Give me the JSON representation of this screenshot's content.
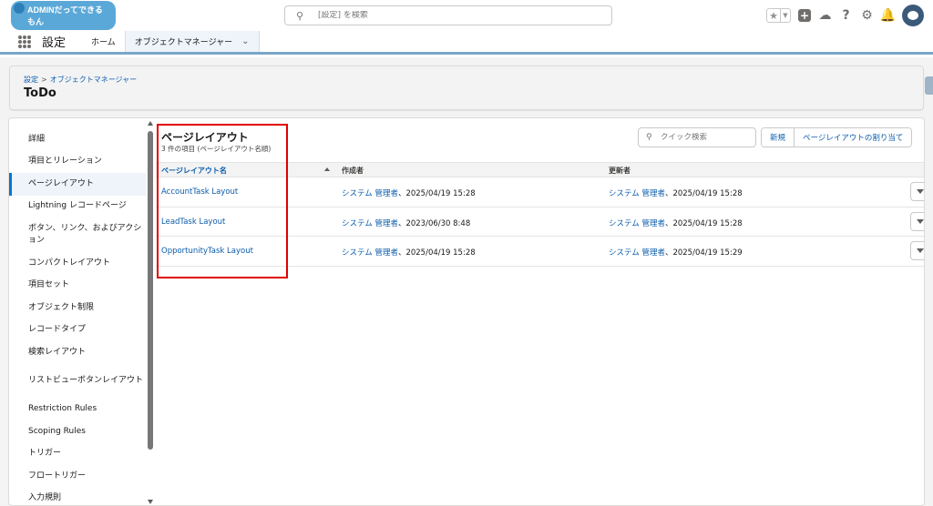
{
  "header": {
    "logo_text": "ADMINだってできるもん",
    "search_placeholder": "[設定] を検索",
    "icons": [
      "star-icon",
      "chevron-down-icon",
      "plus-icon",
      "cloud-icon",
      "help-icon",
      "gear-icon",
      "bell-icon",
      "avatar"
    ]
  },
  "nav": {
    "app_name": "設定",
    "tabs": [
      {
        "label": "ホーム",
        "active": false
      },
      {
        "label": "オブジェクトマネージャー",
        "active": true
      }
    ]
  },
  "object_header": {
    "breadcrumb": [
      "設定",
      "オブジェクトマネージャー"
    ],
    "breadcrumb_sep": ">",
    "title": "ToDo"
  },
  "sidebar": {
    "items": [
      {
        "label": "詳細",
        "active": false
      },
      {
        "label": "項目とリレーション",
        "active": false
      },
      {
        "label": "ページレイアウト",
        "active": true
      },
      {
        "label": "Lightning レコードページ",
        "active": false
      },
      {
        "label": "ボタン、リンク、およびアクション",
        "active": false
      },
      {
        "label": "コンパクトレイアウト",
        "active": false
      },
      {
        "label": "項目セット",
        "active": false
      },
      {
        "label": "オブジェクト制限",
        "active": false
      },
      {
        "label": "レコードタイプ",
        "active": false
      },
      {
        "label": "検索レイアウト",
        "active": false
      },
      {
        "label": "リストビューボタンレイアウト",
        "active": false
      },
      {
        "label": "Restriction Rules",
        "active": false
      },
      {
        "label": "Scoping Rules",
        "active": false
      },
      {
        "label": "トリガー",
        "active": false
      },
      {
        "label": "フロートリガー",
        "active": false
      },
      {
        "label": "入力規則",
        "active": false
      }
    ]
  },
  "main": {
    "title": "ページレイアウト",
    "subtitle": "3 件の項目 (ページレイアウト名順)",
    "quick_search_placeholder": "クイック検索",
    "buttons": {
      "new": "新規",
      "assign": "ページレイアウトの割り当て"
    },
    "columns": [
      "ページレイアウト名",
      "作成者",
      "更新者"
    ],
    "rows": [
      {
        "name": "AccountTask Layout",
        "created_by": "システム 管理者",
        "created_at": "、2025/04/19 15:28",
        "modified_by": "システム 管理者",
        "modified_at": "、2025/04/19 15:28"
      },
      {
        "name": "LeadTask Layout",
        "created_by": "システム 管理者",
        "created_at": "、2023/06/30 8:48",
        "modified_by": "システム 管理者",
        "modified_at": "、2025/04/19 15:28"
      },
      {
        "name": "OpportunityTask Layout",
        "created_by": "システム 管理者",
        "created_at": "、2025/04/19 15:28",
        "modified_by": "システム 管理者",
        "modified_at": "、2025/04/19 15:29"
      }
    ]
  },
  "colors": {
    "link": "#0b5cab",
    "active_accent": "#0176d3",
    "highlight": "#e00000"
  }
}
